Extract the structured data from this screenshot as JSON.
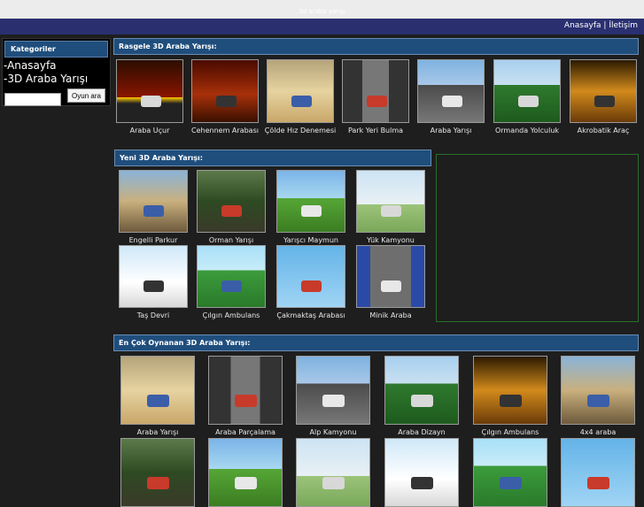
{
  "header": {
    "site_title": "3d araba yarışı"
  },
  "nav": {
    "home": "Anasayfa",
    "separator": "|",
    "contact": "İletişim"
  },
  "sidebar": {
    "title": "Kategoriler",
    "links": [
      "-Anasayfa",
      "-3D Araba Yarışı"
    ],
    "search_placeholder": "",
    "search_button": "Oyun ara"
  },
  "sections": {
    "random": {
      "title": "Rasgele 3D Araba Yarışı:",
      "games": [
        "Araba Uçur",
        "Cehennem Arabası",
        "Çölde Hız Denemesi",
        "Park Yeri Bulma",
        "Araba Yarışı",
        "Ormanda Yolculuk",
        "Akrobatik Araç"
      ]
    },
    "new": {
      "title": "Yeni 3D Araba Yarışı:",
      "games": [
        "Engelli Parkur",
        "Orman Yarışı",
        "Yarışcı Maymun",
        "Yük Kamyonu",
        "Taş Devri",
        "Çılgın Ambulans",
        "Çakmaktaş Arabası",
        "Minik Araba"
      ]
    },
    "popular": {
      "title": "En Çok Oynanan 3D Araba Yarışı:",
      "games": [
        "Araba Yarışı",
        "Araba Parçalama",
        "Alp Kamyonu",
        "Araba Dizayn",
        "Çılgın Ambulans",
        "4x4 araba",
        "",
        "",
        "",
        "",
        "",
        ""
      ]
    }
  },
  "colors": {
    "section_header": "#1f4e7d",
    "nav_bar": "#2a2f70",
    "page_bg": "#1e1e1e",
    "ad_border": "#2a6e2a"
  }
}
